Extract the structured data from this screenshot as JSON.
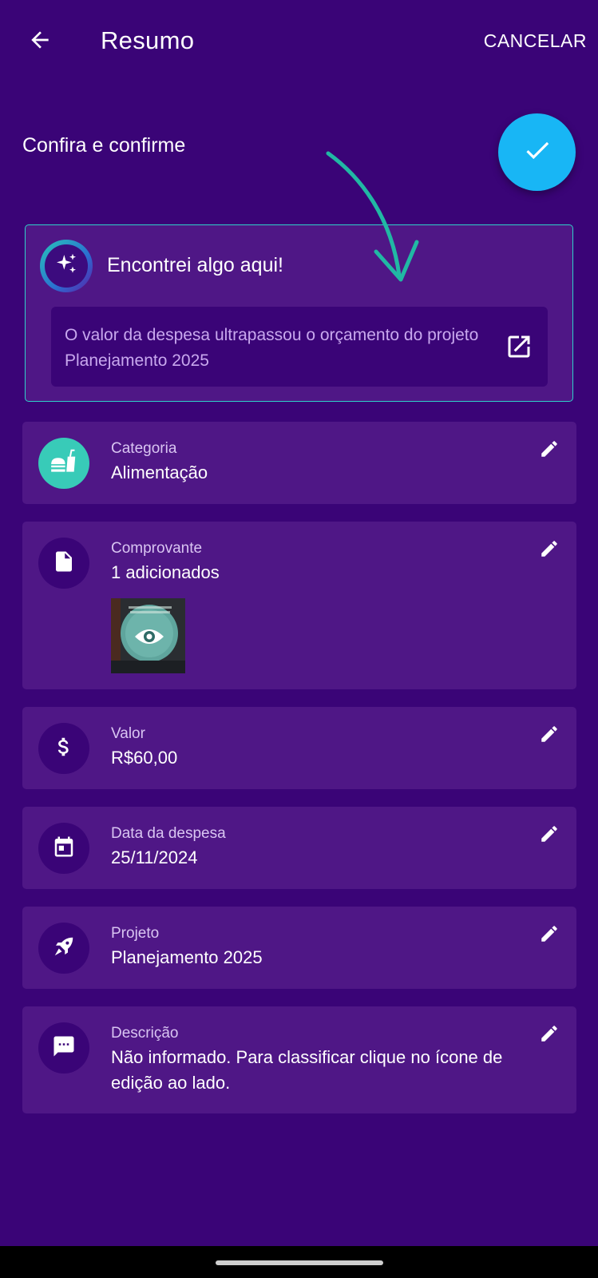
{
  "header": {
    "title": "Resumo",
    "cancel_label": "CANCELAR"
  },
  "subtitle": "Confira e confirme",
  "insight": {
    "title": "Encontrei algo aqui!",
    "message": "O valor da despesa ultrapassou o orçamento do projeto Planejamento 2025"
  },
  "fields": {
    "category": {
      "label": "Categoria",
      "value": "Alimentação"
    },
    "receipt": {
      "label": "Comprovante",
      "value": "1 adicionados"
    },
    "amount": {
      "label": "Valor",
      "value": "R$60,00"
    },
    "date": {
      "label": "Data da despesa",
      "value": "25/11/2024"
    },
    "project": {
      "label": "Projeto",
      "value": "Planejamento 2025"
    },
    "description": {
      "label": "Descrição",
      "value": "Não informado. Para classificar clique no ícone de edição ao lado."
    }
  },
  "icons": {
    "back": "arrow-left-icon",
    "confirm": "check-icon",
    "insight": "sparkles-icon",
    "open": "open-external-icon",
    "category": "food-icon",
    "receipt": "file-icon",
    "amount": "dollar-icon",
    "date": "calendar-icon",
    "project": "rocket-icon",
    "description": "comment-icon",
    "edit": "pencil-icon",
    "view": "eye-icon"
  },
  "colors": {
    "background": "#3a0477",
    "card": "#4f1786",
    "accent_blue": "#18b6f5",
    "accent_teal": "#2fd0c9",
    "muted_text": "#c8a8ee"
  }
}
